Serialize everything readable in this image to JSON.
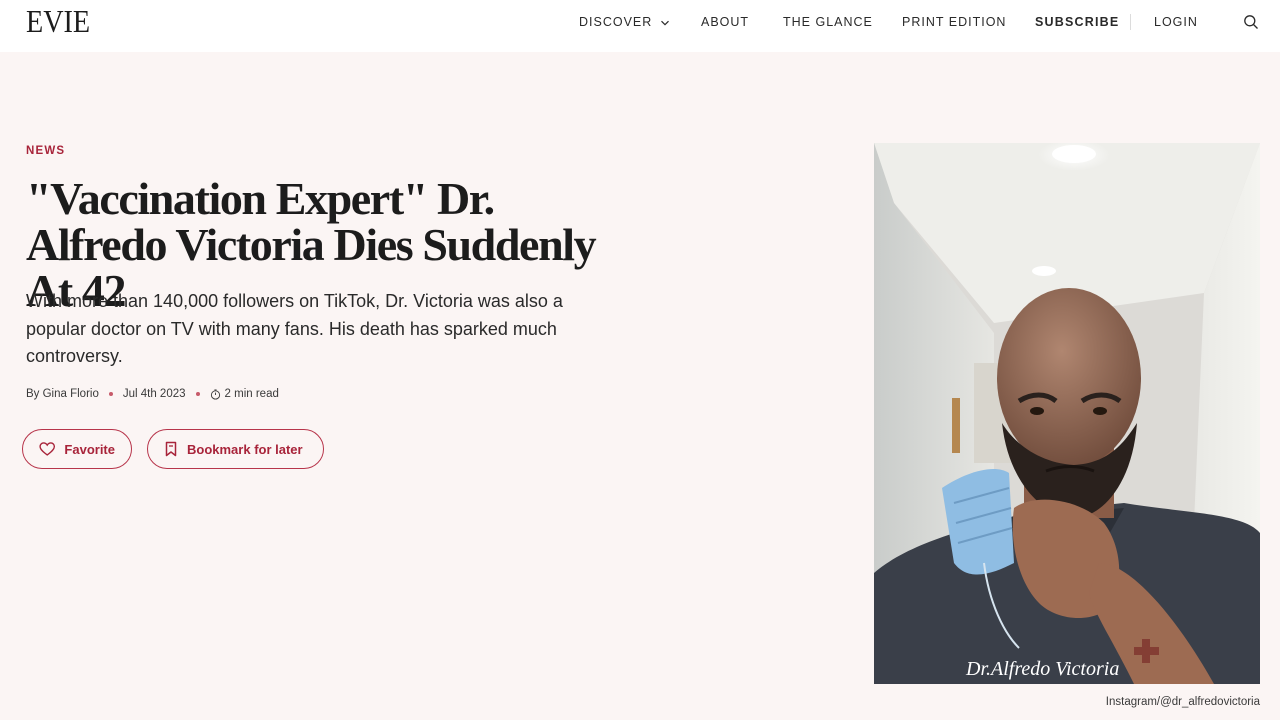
{
  "header": {
    "logo": "EVIE",
    "nav": {
      "discover": "DISCOVER",
      "about": "ABOUT",
      "the_glance": "THE GLANCE",
      "print_edition": "PRINT EDITION",
      "subscribe": "SUBSCRIBE",
      "login": "LOGIN"
    }
  },
  "article": {
    "category": "NEWS",
    "headline": "\"Vaccination Expert\" Dr. Alfredo Victoria Dies Suddenly At 42",
    "dek": "With more than 140,000 followers on TikTok, Dr. Victoria was also a popular doctor on TV with many fans. His death has sparked much controversy.",
    "meta": {
      "byline": "By Gina Florio",
      "date": "Jul 4th 2023",
      "read_time": "2 min read"
    },
    "actions": {
      "favorite": "Favorite",
      "bookmark": "Bookmark for later"
    },
    "photo": {
      "shirt_signature": "Dr.Alfredo Victoria",
      "caption": "Instagram/@dr_alfredovictoria"
    }
  },
  "colors": {
    "accent": "#a8243a",
    "page_bg": "#fbf5f4",
    "header_bg": "#ffffff"
  }
}
